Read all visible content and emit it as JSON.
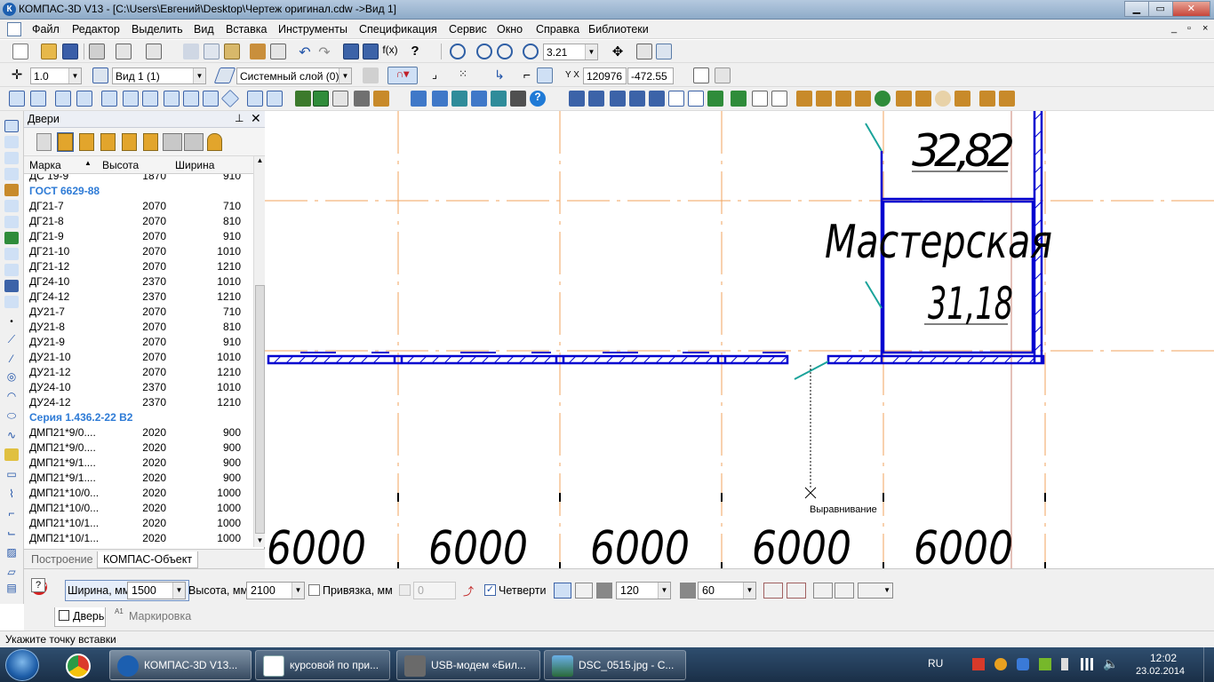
{
  "window": {
    "title": "КОМПАС-3D V13 - [C:\\Users\\Евгений\\Desktop\\Чертеж оригинал.cdw ->Вид 1]",
    "app_icon": "К"
  },
  "menu": {
    "items": [
      "Файл",
      "Редактор",
      "Выделить",
      "Вид",
      "Вставка",
      "Инструменты",
      "Спецификация",
      "Сервис",
      "Окно",
      "Справка",
      "Библиотеки"
    ],
    "mdi_controls": [
      "_",
      "▫",
      "×"
    ]
  },
  "toolbar1": {
    "zoom_value": "3.21"
  },
  "toolbar2": {
    "step_value": "1.0",
    "view_value": "Вид 1 (1)",
    "layer_value": "Системный слой (0)",
    "coord_x": "120976",
    "coord_y": "-472.55"
  },
  "panel": {
    "title": "Двери",
    "columns": {
      "mark": "Марка",
      "height": "Высота",
      "width": "Ширина"
    },
    "rows": [
      {
        "type": "item",
        "mark": "ДС 19-9",
        "height": "1870",
        "width": "910",
        "partial": true
      },
      {
        "type": "group",
        "mark": "ГОСТ 6629-88"
      },
      {
        "type": "item",
        "mark": "ДГ21-7",
        "height": "2070",
        "width": "710"
      },
      {
        "type": "item",
        "mark": "ДГ21-8",
        "height": "2070",
        "width": "810"
      },
      {
        "type": "item",
        "mark": "ДГ21-9",
        "height": "2070",
        "width": "910"
      },
      {
        "type": "item",
        "mark": "ДГ21-10",
        "height": "2070",
        "width": "1010"
      },
      {
        "type": "item",
        "mark": "ДГ21-12",
        "height": "2070",
        "width": "1210"
      },
      {
        "type": "item",
        "mark": "ДГ24-10",
        "height": "2370",
        "width": "1010"
      },
      {
        "type": "item",
        "mark": "ДГ24-12",
        "height": "2370",
        "width": "1210"
      },
      {
        "type": "item",
        "mark": "ДУ21-7",
        "height": "2070",
        "width": "710"
      },
      {
        "type": "item",
        "mark": "ДУ21-8",
        "height": "2070",
        "width": "810"
      },
      {
        "type": "item",
        "mark": "ДУ21-9",
        "height": "2070",
        "width": "910"
      },
      {
        "type": "item",
        "mark": "ДУ21-10",
        "height": "2070",
        "width": "1010"
      },
      {
        "type": "item",
        "mark": "ДУ21-12",
        "height": "2070",
        "width": "1210"
      },
      {
        "type": "item",
        "mark": "ДУ24-10",
        "height": "2370",
        "width": "1010"
      },
      {
        "type": "item",
        "mark": "ДУ24-12",
        "height": "2370",
        "width": "1210"
      },
      {
        "type": "group",
        "mark": "Серия   1.436.2-22 В2"
      },
      {
        "type": "item",
        "mark": "ДМП21*9/0....",
        "height": "2020",
        "width": "900"
      },
      {
        "type": "item",
        "mark": "ДМП21*9/0....",
        "height": "2020",
        "width": "900"
      },
      {
        "type": "item",
        "mark": "ДМП21*9/1....",
        "height": "2020",
        "width": "900"
      },
      {
        "type": "item",
        "mark": "ДМП21*9/1....",
        "height": "2020",
        "width": "900"
      },
      {
        "type": "item",
        "mark": "ДМП21*10/0...",
        "height": "2020",
        "width": "1000"
      },
      {
        "type": "item",
        "mark": "ДМП21*10/0...",
        "height": "2020",
        "width": "1000"
      },
      {
        "type": "item",
        "mark": "ДМП21*10/1...",
        "height": "2020",
        "width": "1000"
      },
      {
        "type": "item",
        "mark": "ДМП21*10/1...",
        "height": "2020",
        "width": "1000"
      }
    ],
    "tabs": [
      "Построение",
      "КОМПАС-Объект"
    ]
  },
  "drawing": {
    "room_area_top": "32,82",
    "room_name": "Мастерская",
    "room_area": "31,18",
    "cursor_hint": "Выравнивание",
    "dimensions": [
      "6000",
      "6000",
      "6000",
      "6000",
      "6000"
    ],
    "colors": {
      "axis": "#f0a35c",
      "wall": "#0000d0",
      "door": "#1aa39a"
    }
  },
  "properties": {
    "width_label": "Ширина, мм",
    "width_value": "1500",
    "height_label": "Высота, мм",
    "height_value": "2100",
    "snap_label": "Привязка, мм",
    "snap_value": "0",
    "snap_checked": false,
    "quarters_label": "Четверти",
    "quarters_checked": true,
    "quarter_depth_value": "120",
    "quarter_width_value": "60",
    "stop_label": "STOP",
    "tabs": [
      "Дверь",
      "Маркировка"
    ]
  },
  "status": {
    "text": "Укажите точку вставки"
  },
  "taskbar": {
    "tasks": [
      "КОМПАС-3D V13...",
      "курсовой по при...",
      "USB-модем «Бил...",
      "DSC_0515.jpg - С..."
    ],
    "lang": "RU",
    "time": "12:02",
    "date": "23.02.2014"
  }
}
